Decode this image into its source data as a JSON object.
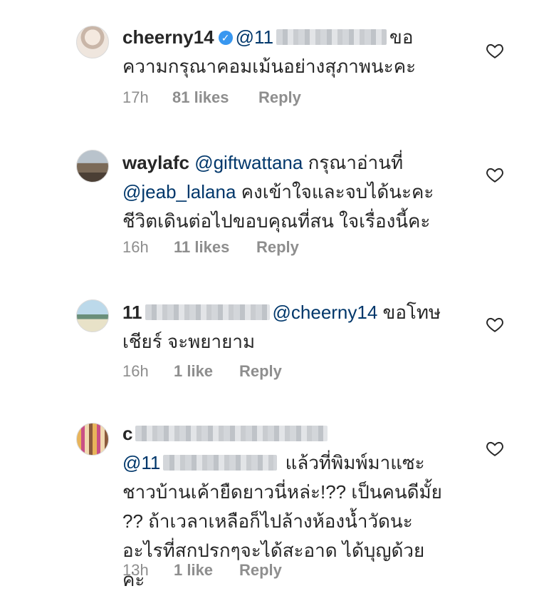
{
  "comments": [
    {
      "username": "cheerny14",
      "mention": "@11",
      "text": "ขอความกรุณาคอมเม้นอย่างสุภาพนะคะ",
      "time": "17h",
      "likes": "81 likes",
      "reply": "Reply"
    },
    {
      "username": "waylafc",
      "mention": "@giftwattana",
      "text_a": "กรุณาอ่านที่",
      "mention2": "@jeab_lalana",
      "text_b": "คงเข้าใจและจบได้นะคะชีวิตเดินต่อไปขอบคุณที่สน ใจเรื่องนี้คะ",
      "time": "16h",
      "likes": "11 likes",
      "reply": "Reply"
    },
    {
      "username": "11",
      "mention": "@cheerny14",
      "text": "ขอโทษเชียร์ จะพยายาม",
      "time": "16h",
      "likes": "1 like",
      "reply": "Reply"
    },
    {
      "username": "c",
      "mention": "@11",
      "text": "แล้วที่พิมพ์มาแซะชาวบ้านเค้ายืดยาวนี่หล่ะ!?? เป็นคนดีมั้ย ?? ถ้าเวลาเหลือก็ไปล้างห้องน้ำวัดนะ อะไรที่สกปรกๆจะได้สะอาด ได้บุญด้วยค่ะ",
      "time": "13h",
      "likes": "1 like",
      "reply": "Reply"
    }
  ],
  "icons": {
    "verified": "verified-badge-icon",
    "like": "heart-outline-icon"
  },
  "colors": {
    "mention": "#00376b",
    "meta": "#8e8e8e",
    "verified": "#3897f0"
  }
}
